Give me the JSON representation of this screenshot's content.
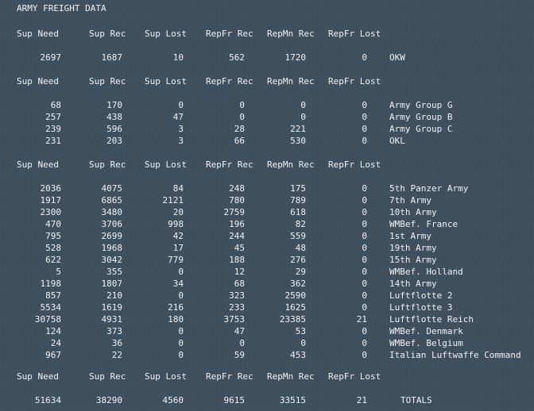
{
  "title": "ARMY FREIGHT DATA",
  "headers": [
    "Sup Need",
    "Sup Rec",
    "Sup Lost",
    "RepFr Rec",
    "RepMn Rec",
    "RepFr Lost"
  ],
  "sections": [
    {
      "rows": [
        {
          "values": [
            "2697",
            "1687",
            "10",
            "562",
            "1720",
            "0"
          ],
          "name": "OKW"
        }
      ]
    },
    {
      "rows": [
        {
          "values": [
            "68",
            "170",
            "0",
            "0",
            "0",
            "0"
          ],
          "name": "Army Group G"
        },
        {
          "values": [
            "257",
            "438",
            "47",
            "0",
            "0",
            "0"
          ],
          "name": "Army Group B"
        },
        {
          "values": [
            "239",
            "596",
            "3",
            "28",
            "221",
            "0"
          ],
          "name": "Army Group C"
        },
        {
          "values": [
            "231",
            "203",
            "3",
            "66",
            "530",
            "0"
          ],
          "name": "OKL"
        }
      ]
    },
    {
      "rows": [
        {
          "values": [
            "2036",
            "4075",
            "84",
            "248",
            "175",
            "0"
          ],
          "name": "5th Panzer Army"
        },
        {
          "values": [
            "1917",
            "6865",
            "2121",
            "780",
            "789",
            "0"
          ],
          "name": "7th Army"
        },
        {
          "values": [
            "2300",
            "3480",
            "20",
            "2759",
            "618",
            "0"
          ],
          "name": "10th Army"
        },
        {
          "values": [
            "470",
            "3706",
            "998",
            "196",
            "82",
            "0"
          ],
          "name": "WMBef. France"
        },
        {
          "values": [
            "795",
            "2699",
            "42",
            "244",
            "559",
            "0"
          ],
          "name": "1st Army"
        },
        {
          "values": [
            "528",
            "1968",
            "17",
            "45",
            "48",
            "0"
          ],
          "name": "19th Army"
        },
        {
          "values": [
            "622",
            "3042",
            "779",
            "188",
            "276",
            "0"
          ],
          "name": "15th Army"
        },
        {
          "values": [
            "5",
            "355",
            "0",
            "12",
            "29",
            "0"
          ],
          "name": "WMBef. Holland"
        },
        {
          "values": [
            "1198",
            "1807",
            "34",
            "68",
            "362",
            "0"
          ],
          "name": "14th Army"
        },
        {
          "values": [
            "857",
            "210",
            "0",
            "323",
            "2590",
            "0"
          ],
          "name": "Luftflotte 2"
        },
        {
          "values": [
            "5534",
            "1619",
            "216",
            "233",
            "1625",
            "0"
          ],
          "name": "Luftflotte 3"
        },
        {
          "values": [
            "30758",
            "4931",
            "180",
            "3753",
            "23385",
            "21"
          ],
          "name": "Luftflotte Reich"
        },
        {
          "values": [
            "124",
            "373",
            "0",
            "47",
            "53",
            "0"
          ],
          "name": "WMBef. Denmark"
        },
        {
          "values": [
            "24",
            "36",
            "0",
            "0",
            "0",
            "0"
          ],
          "name": "WMBef. Belgium"
        },
        {
          "values": [
            "967",
            "22",
            "0",
            "59",
            "453",
            "0"
          ],
          "name": "Italian Luftwaffe Command"
        }
      ]
    },
    {
      "rows": [
        {
          "values": [
            "51634",
            "38290",
            "4560",
            "9615",
            "33515",
            "21"
          ],
          "name": "TOTALS"
        }
      ]
    }
  ]
}
